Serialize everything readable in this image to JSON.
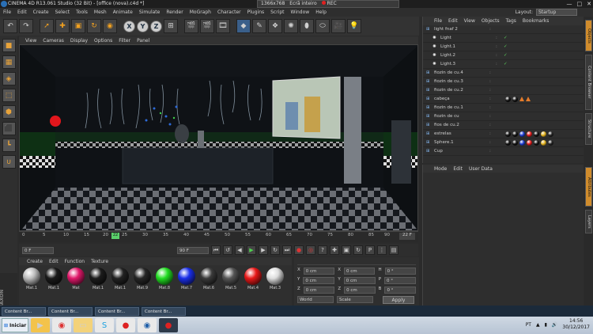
{
  "window": {
    "title": "CINEMA 4D R13.061 Studio (32 Bit) - [office (nova).c4d *]",
    "controls": [
      "—",
      "□",
      "✕"
    ]
  },
  "recorder": {
    "resolution": "1366x768",
    "mode": "Ecrã inteiro",
    "rec_label": "REC"
  },
  "menu": [
    "File",
    "Edit",
    "Create",
    "Select",
    "Tools",
    "Mesh",
    "Animate",
    "Simulate",
    "Render",
    "MoGraph",
    "Character",
    "Plugins",
    "Script",
    "Window",
    "Help"
  ],
  "layout": {
    "label": "Layout:",
    "value": "Startup"
  },
  "viewport_menu": [
    "View",
    "Cameras",
    "Display",
    "Options",
    "Filter",
    "Panel"
  ],
  "toolbar": {
    "axis_x": "X",
    "axis_y": "Y",
    "axis_z": "Z"
  },
  "timeline": {
    "ticks": [
      "0",
      "5",
      "10",
      "15",
      "20",
      "25",
      "30",
      "35",
      "40",
      "45",
      "50",
      "55",
      "60",
      "65",
      "70",
      "75",
      "80",
      "85",
      "90"
    ],
    "current_frame": "22",
    "end_frame": "22 F"
  },
  "transport": {
    "start_field": "0 F",
    "end_field": "90 F"
  },
  "materials": {
    "menu": [
      "Create",
      "Edit",
      "Function",
      "Texture"
    ],
    "row1": [
      {
        "label": "Mat.1",
        "color": "#bdbdbd"
      },
      {
        "label": "Mat.1",
        "color": "#1a1a1a"
      },
      {
        "label": "Mat",
        "color": "#e0186a"
      },
      {
        "label": "Mat.1",
        "color": "#1c1c1c"
      },
      {
        "label": "Mat.1",
        "color": "#222222"
      },
      {
        "label": "Mat.9",
        "color": "#262626"
      },
      {
        "label": "Mat.8",
        "color": "#22dd22"
      },
      {
        "label": "Mat.7",
        "color": "#1a2ee8"
      },
      {
        "label": "Mat.6",
        "color": "#3a3a3a"
      },
      {
        "label": "Mat.5",
        "color": "#555555"
      },
      {
        "label": "Mat.4",
        "color": "#e81818"
      },
      {
        "label": "Mat.3",
        "color": "#dddddd"
      }
    ]
  },
  "coords": {
    "rows": [
      {
        "a": "X",
        "av": "0 cm",
        "b": "X",
        "bv": "0 cm",
        "c": "H",
        "cv": "0 °"
      },
      {
        "a": "Y",
        "av": "0 cm",
        "b": "Y",
        "bv": "0 cm",
        "c": "P",
        "cv": "0 °"
      },
      {
        "a": "Z",
        "av": "0 cm",
        "b": "Z",
        "bv": "0 cm",
        "c": "B",
        "cv": "0 °"
      }
    ],
    "mode_world": "World",
    "mode_scale": "Scale",
    "apply": "Apply"
  },
  "object_manager": {
    "menu": [
      "File",
      "Edit",
      "View",
      "Objects",
      "Tags",
      "Bookmarks"
    ],
    "objects": [
      {
        "name": "light fnaf 2",
        "indent": 0
      },
      {
        "name": "Light",
        "indent": 1
      },
      {
        "name": "Light.1",
        "indent": 1
      },
      {
        "name": "Light.2",
        "indent": 1
      },
      {
        "name": "Light.3",
        "indent": 1
      },
      {
        "name": "fiozin de cu.4",
        "indent": 0
      },
      {
        "name": "fiozin de cu.3",
        "indent": 0
      },
      {
        "name": "fiozin de cu.2",
        "indent": 0
      },
      {
        "name": "cabeça",
        "indent": 0
      },
      {
        "name": "fiozin de cu.1",
        "indent": 0
      },
      {
        "name": "fiozin de cu",
        "indent": 0
      },
      {
        "name": "fios de cu.2",
        "indent": 0
      },
      {
        "name": "estrelas",
        "indent": 0
      },
      {
        "name": "Sphere.1",
        "indent": 0
      },
      {
        "name": "Cup",
        "indent": 0
      }
    ]
  },
  "attribute_manager": {
    "menu": [
      "Mode",
      "Edit",
      "User Data"
    ]
  },
  "right_tabs": [
    "Objects",
    "Content Browser",
    "Structure",
    "Attributes",
    "Layers"
  ],
  "taskbar_items": [
    "Content Br...",
    "Content Br...",
    "Content Br...",
    "Content Br..."
  ],
  "windows_taskbar": {
    "start": "Iniciar",
    "language": "PT",
    "time": "14:56",
    "date": "30/12/2017"
  }
}
